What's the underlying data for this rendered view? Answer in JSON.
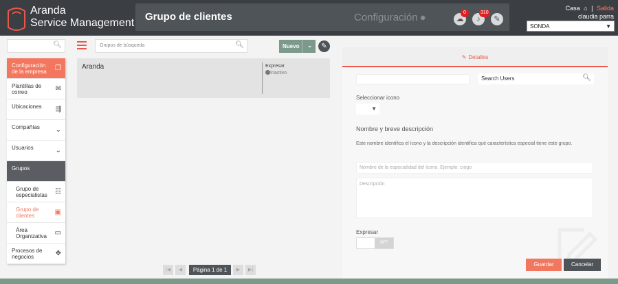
{
  "header": {
    "brand_line1": "Aranda",
    "brand_line2": "Service Management",
    "page_title": "Grupo de clientes",
    "config_label": "Configuración",
    "notifications": [
      {
        "icon": "cloud-icon",
        "count": "0"
      },
      {
        "icon": "bell-icon",
        "count": "310"
      },
      {
        "icon": "tools-icon",
        "count": ""
      }
    ],
    "home_label": "Casa",
    "separator": "|",
    "logout_label": "Salida",
    "user_name": "claudia parra",
    "project_select": "SONDA"
  },
  "sidebar": {
    "items": [
      {
        "label": "Configuración de la empresa",
        "icon": "copy-icon"
      },
      {
        "label": "Plantillas de correo",
        "icon": "mail-icon"
      },
      {
        "label": "Ubicaciones",
        "icon": "signpost-icon"
      },
      {
        "label": "Compañías",
        "icon": "chevron-down-icon"
      },
      {
        "label": "Usuarios",
        "icon": "chevron-down-icon"
      },
      {
        "label": "Grupos",
        "icon": ""
      },
      {
        "label": "Grupo de especialistas",
        "icon": "people-icon"
      },
      {
        "label": "Grupo de clientes",
        "icon": "client-group-icon"
      },
      {
        "label": "Área Organizativa",
        "icon": "org-icon"
      },
      {
        "label": "Procesos de negocios",
        "icon": "process-icon"
      }
    ]
  },
  "toolbar": {
    "search_placeholder": "Grupos de búsqueda",
    "new_label": "Nuevo"
  },
  "list": {
    "items": [
      {
        "name": "Aranda",
        "expire_label": "Expresar",
        "status": "Inactivo"
      }
    ]
  },
  "pager": {
    "label": "Página 1 de 1",
    "first": "|◀",
    "prev": "◀",
    "next": "▶",
    "last": "▶|"
  },
  "details": {
    "tab_label": "Detalles",
    "search_users": "Search Users",
    "select_icon_label": "Seleccionar icono",
    "section_title": "Nombre y breve descripción",
    "section_desc": "Este nombre identifica el ícono y la descripción identifica qué característica especial tiene este grupo.",
    "name_placeholder": "Nombre de la especialidad del ícono.  Ejemplo: ciego",
    "desc_placeholder": "Descripción",
    "expire_label": "Expresar",
    "toggle_label": "OFF",
    "save_label": "Guardar",
    "cancel_label": "Cancelar"
  },
  "colors": {
    "accent": "#f2775e",
    "header": "#3b3f44",
    "green": "#7c9a8c"
  }
}
